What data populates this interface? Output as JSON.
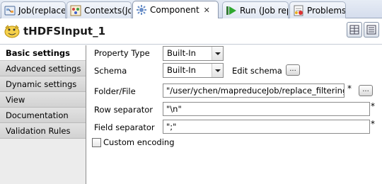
{
  "tabs": [
    {
      "label": "Job(replace",
      "icon": "job-icon"
    },
    {
      "label": "Contexts(Jo",
      "icon": "contexts-icon"
    },
    {
      "label": "Component",
      "icon": "component-icon",
      "active": true
    },
    {
      "label": "Run (Job rep",
      "icon": "run-icon"
    },
    {
      "label": "Problems",
      "icon": "problems-icon"
    }
  ],
  "header": {
    "title": "tHDFSInput_1"
  },
  "sidebar": {
    "items": [
      {
        "label": "Basic settings",
        "active": true
      },
      {
        "label": "Advanced settings"
      },
      {
        "label": "Dynamic settings"
      },
      {
        "label": "View"
      },
      {
        "label": "Documentation"
      },
      {
        "label": "Validation Rules"
      }
    ]
  },
  "form": {
    "property_type": {
      "label": "Property Type",
      "value": "Built-In"
    },
    "schema": {
      "label": "Schema",
      "value": "Built-In",
      "edit_label": "Edit schema",
      "button": "..."
    },
    "folder_file": {
      "label": "Folder/File",
      "value": "\"/user/ychen/mapreduceJob/replace_filtering\"",
      "required": "*",
      "button": "..."
    },
    "row_separator": {
      "label": "Row separator",
      "value": "\"\\n\"",
      "required": "*"
    },
    "field_separator": {
      "label": "Field separator",
      "value": "\";\"",
      "required": "*"
    },
    "custom_encoding": {
      "label": "Custom encoding",
      "checked": false
    }
  }
}
